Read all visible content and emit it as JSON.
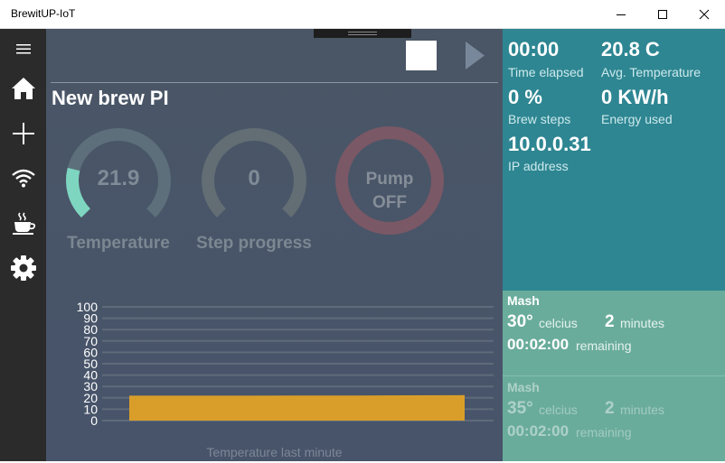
{
  "window": {
    "title": "BrewitUP-IoT"
  },
  "nav": {
    "items": [
      {
        "icon": "hamburger-icon"
      },
      {
        "icon": "home-icon"
      },
      {
        "icon": "add-icon"
      },
      {
        "icon": "wifi-icon"
      },
      {
        "icon": "coffee-cup-icon"
      },
      {
        "icon": "gear-icon"
      }
    ]
  },
  "main": {
    "title": "New brew PI",
    "gauges": [
      {
        "value": "21.9",
        "label": "Temperature",
        "fill_fraction": 0.219
      },
      {
        "value": "0",
        "label": "Step progress",
        "fill_fraction": 0
      },
      {
        "value_line1": "Pump",
        "value_line2": "OFF"
      }
    ],
    "chart_caption": "Temperature last minute"
  },
  "chart_data": {
    "type": "area",
    "title": "",
    "xlabel": "Temperature last minute",
    "ylabel": "",
    "ylim": [
      0,
      100
    ],
    "yticks": [
      0,
      10,
      20,
      30,
      40,
      50,
      60,
      70,
      80,
      90,
      100
    ],
    "grid": true,
    "series": [
      {
        "values": [
          21.9,
          21.9,
          21.9,
          22.0,
          22.0,
          22.2,
          22.4
        ]
      }
    ],
    "colors": {
      "fill": "#d99e29"
    }
  },
  "stats": {
    "time_elapsed": {
      "value": "00:00",
      "label": "Time elapsed"
    },
    "avg_temperature": {
      "value": "20.8 C",
      "label": "Avg. Temperature"
    },
    "brew_steps": {
      "value": "0 %",
      "label": "Brew steps"
    },
    "energy_used": {
      "value": "0 KW/h",
      "label": "Energy used"
    },
    "ip_address": {
      "value": "10.0.0.31",
      "label": "IP address"
    }
  },
  "steps": [
    {
      "name": "Mash",
      "temp": "30°",
      "temp_unit": "celcius",
      "minutes": "2",
      "minutes_unit": "minutes",
      "remaining_time": "00:02:00",
      "remaining_label": "remaining"
    },
    {
      "name": "Mash",
      "temp": "35°",
      "temp_unit": "celcius",
      "minutes": "2",
      "minutes_unit": "minutes",
      "remaining_time": "00:02:00",
      "remaining_label": "remaining"
    }
  ],
  "colors": {
    "temperature_arc": "#7ed6c1",
    "gauge_track": "#5c6f7a",
    "pump_ring": "#7a5866",
    "stats_bg": "#2e8692",
    "steps_bg": "#6aac9b"
  }
}
